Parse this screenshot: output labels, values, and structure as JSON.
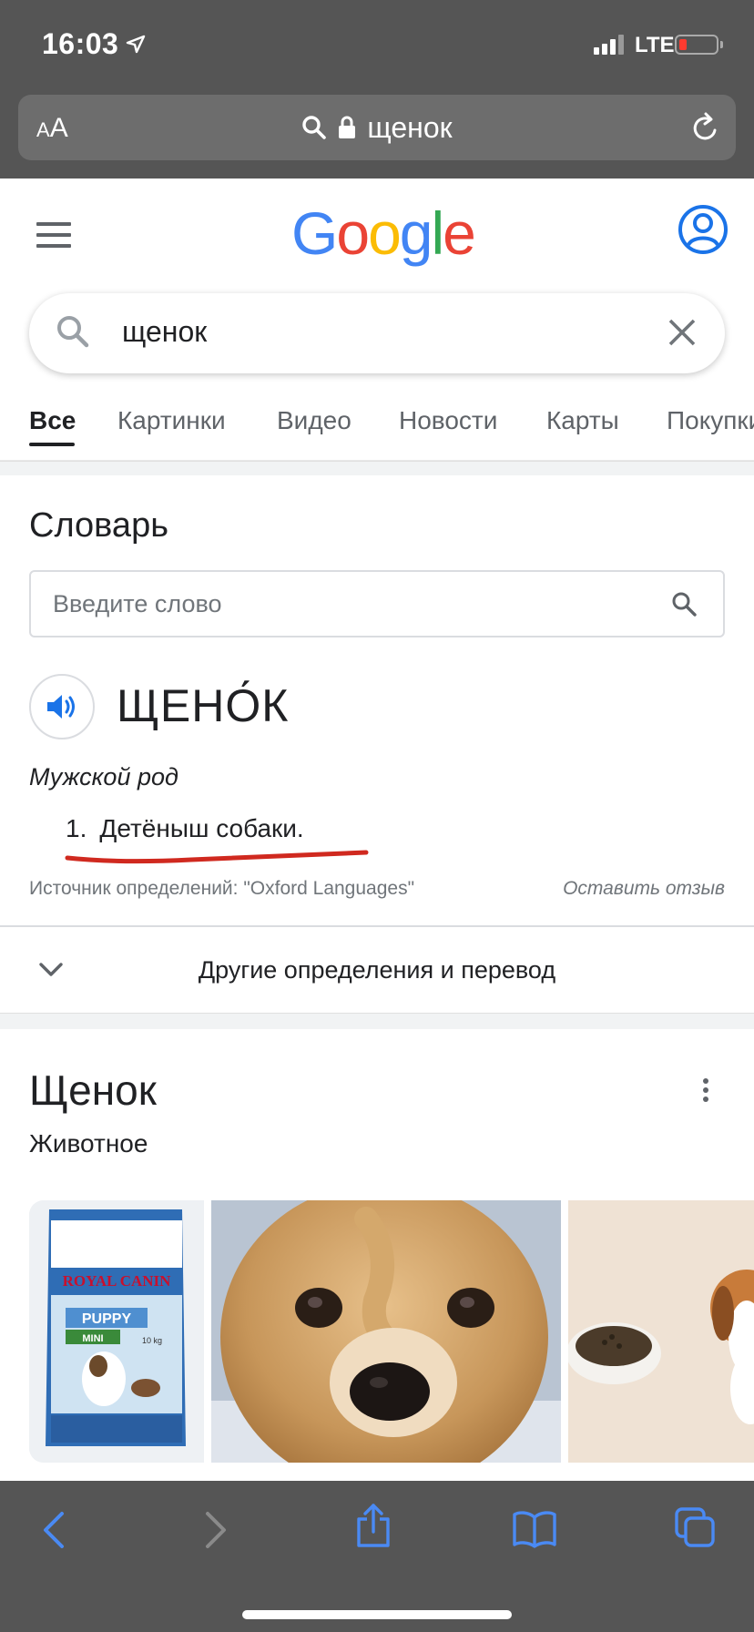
{
  "status": {
    "time": "16:03",
    "network": "LTE"
  },
  "urlbar": {
    "aa_label": "AA",
    "query": "щенок"
  },
  "google": {
    "logo": [
      "G",
      "o",
      "o",
      "g",
      "l",
      "e"
    ],
    "logo_colors": [
      "#4285F4",
      "#EA4335",
      "#FBBC05",
      "#4285F4",
      "#34A853",
      "#EA4335"
    ],
    "search_value": "щенок"
  },
  "tabs": [
    "Все",
    "Картинки",
    "Видео",
    "Новости",
    "Карты",
    "Покупки"
  ],
  "dictionary": {
    "title": "Словарь",
    "input_placeholder": "Введите слово",
    "word": "ЩЕНО́К",
    "part_of_speech": "Мужской род",
    "definitions": [
      {
        "num": "1.",
        "text": "Детёныш собаки."
      }
    ],
    "source": "Источник определений: \"Oxford Languages\"",
    "feedback": "Оставить отзыв",
    "more": "Другие определения и перевод"
  },
  "knowledge_panel": {
    "title": "Щенок",
    "subtitle": "Животное",
    "product_brand": "ROYAL CANIN",
    "product_line": "PUPPY",
    "product_variant": "MINI",
    "product_weight": "10 kg"
  },
  "icons": {
    "reload": "reload-icon",
    "search": "search-icon",
    "clear": "close-icon",
    "speaker": "speaker-icon",
    "chevron": "chevron-down-icon",
    "back": "back-icon",
    "forward": "forward-icon",
    "share": "share-icon",
    "bookmarks": "bookmarks-icon",
    "tabs": "tabs-icon"
  },
  "colors": {
    "safari_chrome": "#555555",
    "safari_icon": "#4a8af4",
    "google_blue": "#4285F4",
    "annotation_red": "#d0291f"
  }
}
